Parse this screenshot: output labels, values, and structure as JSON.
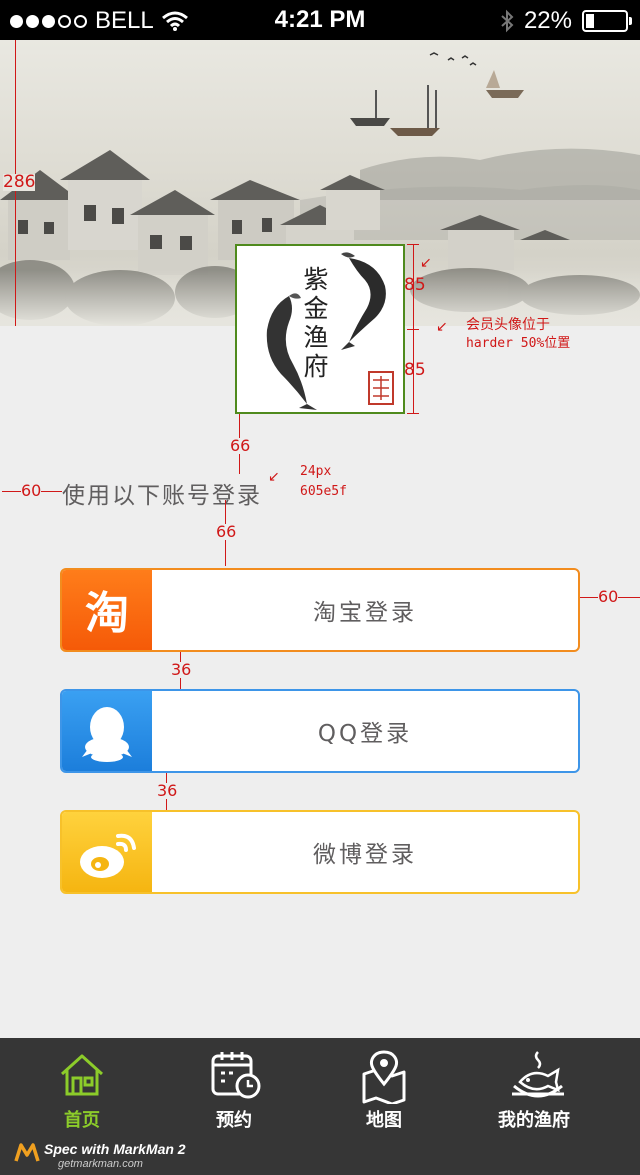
{
  "status_bar": {
    "carrier": "BELL",
    "time": "4:21 PM",
    "battery_text": "22%",
    "battery_level": 0.22,
    "signal_bars_filled": 3,
    "signal_bars_total": 5
  },
  "avatar": {
    "seal_text": "紫金渔府"
  },
  "login": {
    "prompt": "使用以下账号登录",
    "buttons": [
      {
        "label": "淘宝登录",
        "icon": "taobao-icon",
        "color": "#ff6a00"
      },
      {
        "label": "QQ登录",
        "icon": "qq-icon",
        "color": "#2a8ee6"
      },
      {
        "label": "微博登录",
        "icon": "weibo-icon",
        "color": "#fbbd22"
      }
    ]
  },
  "bottom_nav": {
    "items": [
      {
        "label": "首页",
        "icon": "home-icon",
        "active": true
      },
      {
        "label": "预约",
        "icon": "calendar-clock-icon",
        "active": false
      },
      {
        "label": "地图",
        "icon": "map-icon",
        "active": false
      },
      {
        "label": "我的渔府",
        "icon": "fish-dish-icon",
        "active": false
      }
    ]
  },
  "annotations": {
    "banner_height": "286",
    "avatar_top_half": "85",
    "avatar_bottom_half": "85",
    "avatar_note_line1": "会员头像位于",
    "avatar_note_line2": "harder 50%位置",
    "gap_avatar_prompt": "66",
    "prompt_left_margin": "60",
    "prompt_font_line1": "24px",
    "prompt_font_line2": "605e5f",
    "gap_prompt_button": "66",
    "button_right_margin": "60",
    "button_gap_1": "36",
    "button_gap_2": "36"
  },
  "watermark": {
    "line1": "Spec with MarkMan 2",
    "line2": "getmarkman.com"
  }
}
